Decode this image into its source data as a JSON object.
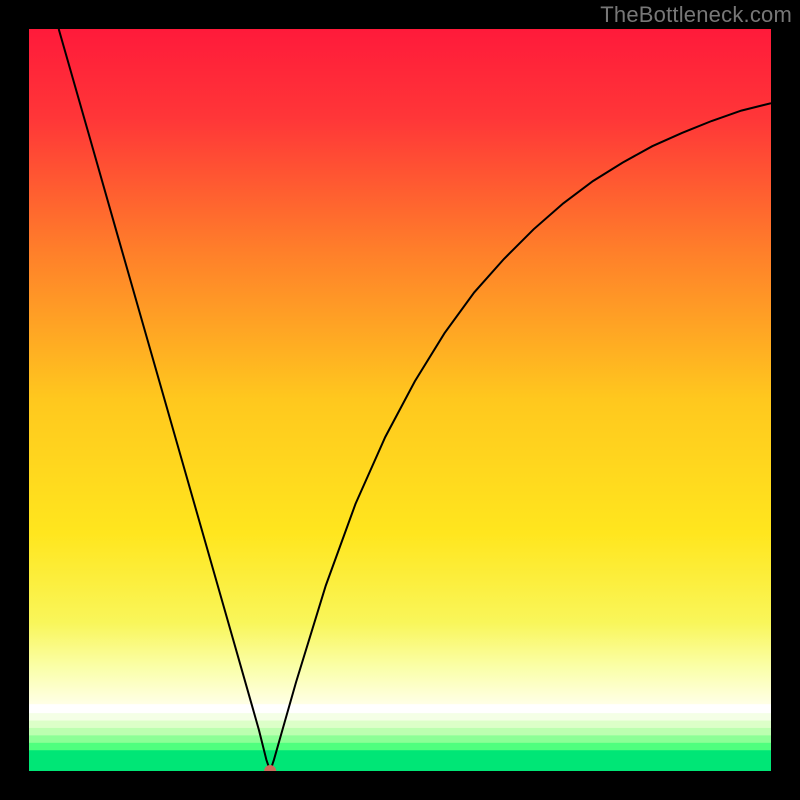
{
  "watermark": "TheBottleneck.com",
  "chart_data": {
    "type": "line",
    "title": "",
    "xlabel": "",
    "ylabel": "",
    "xlim": [
      0,
      100
    ],
    "ylim": [
      0,
      100
    ],
    "grid": false,
    "legend": false,
    "marker": {
      "x": 32.5,
      "y": 0,
      "color": "#cc6a5a"
    },
    "series": [
      {
        "name": "curve",
        "x": [
          4,
          8,
          12,
          16,
          20,
          24,
          28,
          30,
          31,
          32,
          32.5,
          33,
          34,
          36,
          40,
          44,
          48,
          52,
          56,
          60,
          64,
          68,
          72,
          76,
          80,
          84,
          88,
          92,
          96,
          100
        ],
        "values": [
          100,
          86,
          72,
          58,
          44,
          30,
          16,
          9,
          5.5,
          1.5,
          0,
          1.5,
          5,
          12,
          25,
          36,
          45,
          52.5,
          59,
          64.5,
          69,
          73,
          76.5,
          79.5,
          82,
          84.2,
          86,
          87.6,
          89,
          90
        ]
      }
    ],
    "background": {
      "gradient": {
        "stops": [
          {
            "offset": 0.0,
            "color": "#ff1a3a"
          },
          {
            "offset": 0.12,
            "color": "#ff3638"
          },
          {
            "offset": 0.3,
            "color": "#ff7f2a"
          },
          {
            "offset": 0.5,
            "color": "#ffc81e"
          },
          {
            "offset": 0.68,
            "color": "#ffe61e"
          },
          {
            "offset": 0.8,
            "color": "#f9f65a"
          },
          {
            "offset": 0.86,
            "color": "#faffa8"
          },
          {
            "offset": 0.91,
            "color": "#ffffe6"
          }
        ]
      },
      "bottom_bands": [
        {
          "y": 0.91,
          "h": 0.012,
          "color": "#ffffff"
        },
        {
          "y": 0.922,
          "h": 0.01,
          "color": "#f4ffe6"
        },
        {
          "y": 0.932,
          "h": 0.01,
          "color": "#dcffc8"
        },
        {
          "y": 0.942,
          "h": 0.01,
          "color": "#bcffb0"
        },
        {
          "y": 0.952,
          "h": 0.01,
          "color": "#8cff96"
        },
        {
          "y": 0.962,
          "h": 0.01,
          "color": "#4fff7e"
        },
        {
          "y": 0.972,
          "h": 0.028,
          "color": "#00e676"
        }
      ]
    }
  }
}
